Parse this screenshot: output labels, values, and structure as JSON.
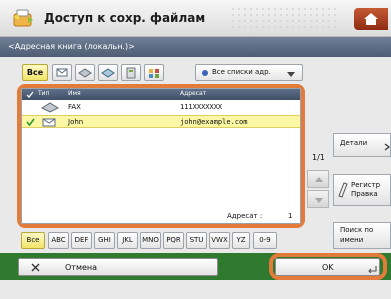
{
  "header": {
    "title": "Доступ к сохр. файлам"
  },
  "subheader": {
    "breadcrumb": "<Адресная книга (локальн.)>"
  },
  "filters": {
    "all_label": "Все",
    "dropdown_value": "Все списки адр."
  },
  "list": {
    "columns": {
      "type": "Тип",
      "name": "Имя",
      "address": "Адресат"
    },
    "rows": [
      {
        "type_icon": "fax-icon",
        "name": "FAX",
        "address": "111XXXXXXX",
        "selected": false
      },
      {
        "type_icon": "email-icon",
        "name": "John",
        "address": "john@example.com",
        "selected": true
      }
    ],
    "count_label": "Адресат :",
    "count_value": "1"
  },
  "side": {
    "details_label": "Детали",
    "page": "1/1",
    "register_label_1": "Регистр",
    "register_label_2": "Правка",
    "search_label_1": "Поиск по",
    "search_label_2": "имени"
  },
  "alphabet": [
    "Все",
    "ABC",
    "DEF",
    "GHI",
    "JKL",
    "MNO",
    "PQR",
    "STU",
    "VWX",
    "YZ",
    "0-9"
  ],
  "actions": {
    "cancel_label": "Отмена",
    "ok_label": "OK"
  },
  "colors": {
    "accent_orange": "#e37b3a",
    "bottom_green": "#2f7a2e",
    "header_blue": "#4e5d73",
    "selected_row": "#fbf7a4"
  }
}
